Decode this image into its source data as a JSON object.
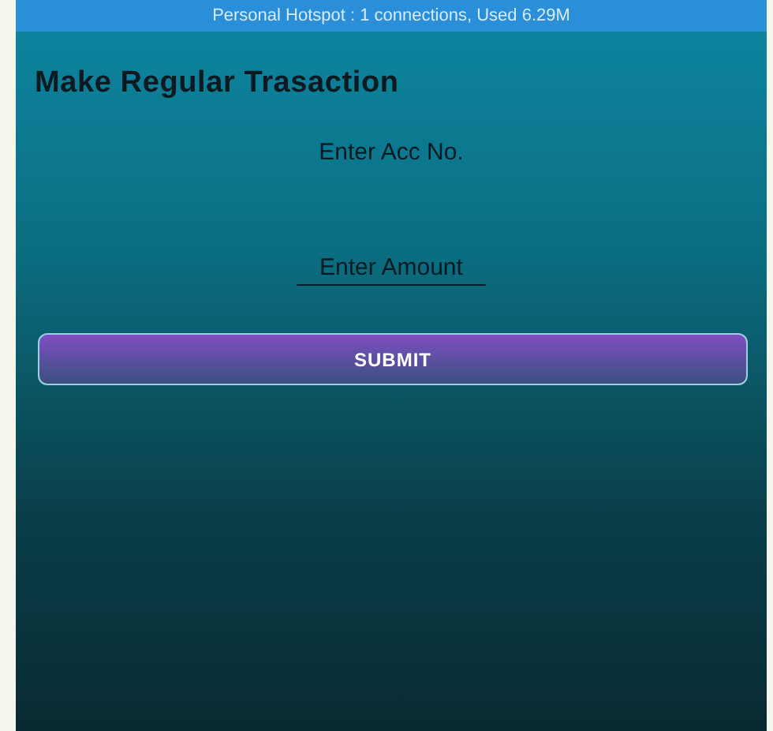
{
  "status_bar": {
    "text": "Personal Hotspot : 1 connections, Used 6.29M"
  },
  "title": "Make Regular Trasaction",
  "fields": [
    {
      "placeholder": "Enter Acc No."
    },
    {
      "placeholder": "Enter Amount"
    }
  ],
  "buttons": [
    "SUBMIT"
  ]
}
